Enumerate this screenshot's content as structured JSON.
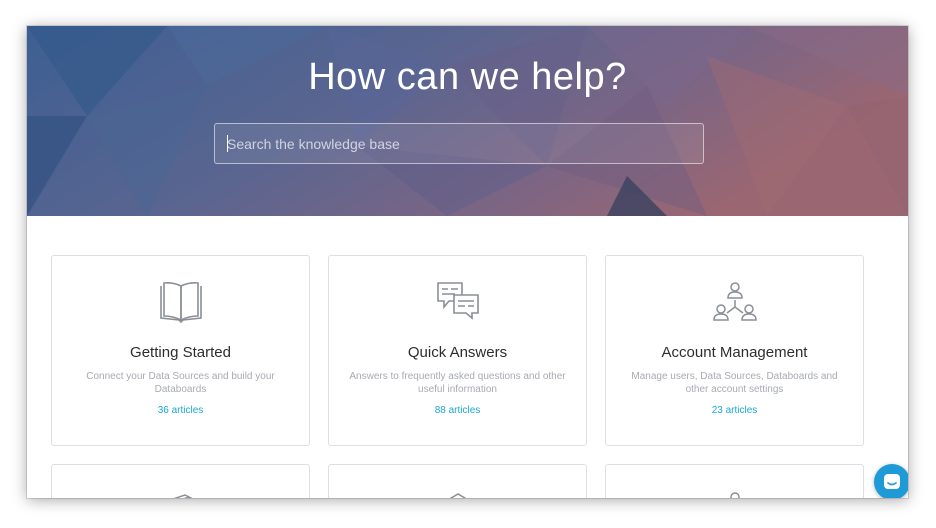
{
  "hero": {
    "title": "How can we help?",
    "search_placeholder": "Search the knowledge base"
  },
  "cards": [
    {
      "icon": "open-book-icon",
      "title": "Getting Started",
      "description": "Connect your Data Sources and build your Databoards",
      "count": "36 articles"
    },
    {
      "icon": "chat-bubbles-icon",
      "title": "Quick Answers",
      "description": "Answers to frequently asked questions and other useful information",
      "count": "88 articles"
    },
    {
      "icon": "user-hierarchy-icon",
      "title": "Account Management",
      "description": "Manage users, Data Sources, Databoards and other account settings",
      "count": "23 articles"
    }
  ],
  "partial_cards": [
    {
      "icon": "cards-stack-icon"
    },
    {
      "icon": "cube-icon"
    },
    {
      "icon": "person-icon"
    }
  ],
  "chat": {
    "icon": "chat-launcher-icon"
  },
  "colors": {
    "accent": "#1ba8d2",
    "hero_blue": "#4e5f8c",
    "hero_rose": "#8f6270",
    "chat_button": "#1e9bd6",
    "card_border": "#dcdfe4"
  }
}
